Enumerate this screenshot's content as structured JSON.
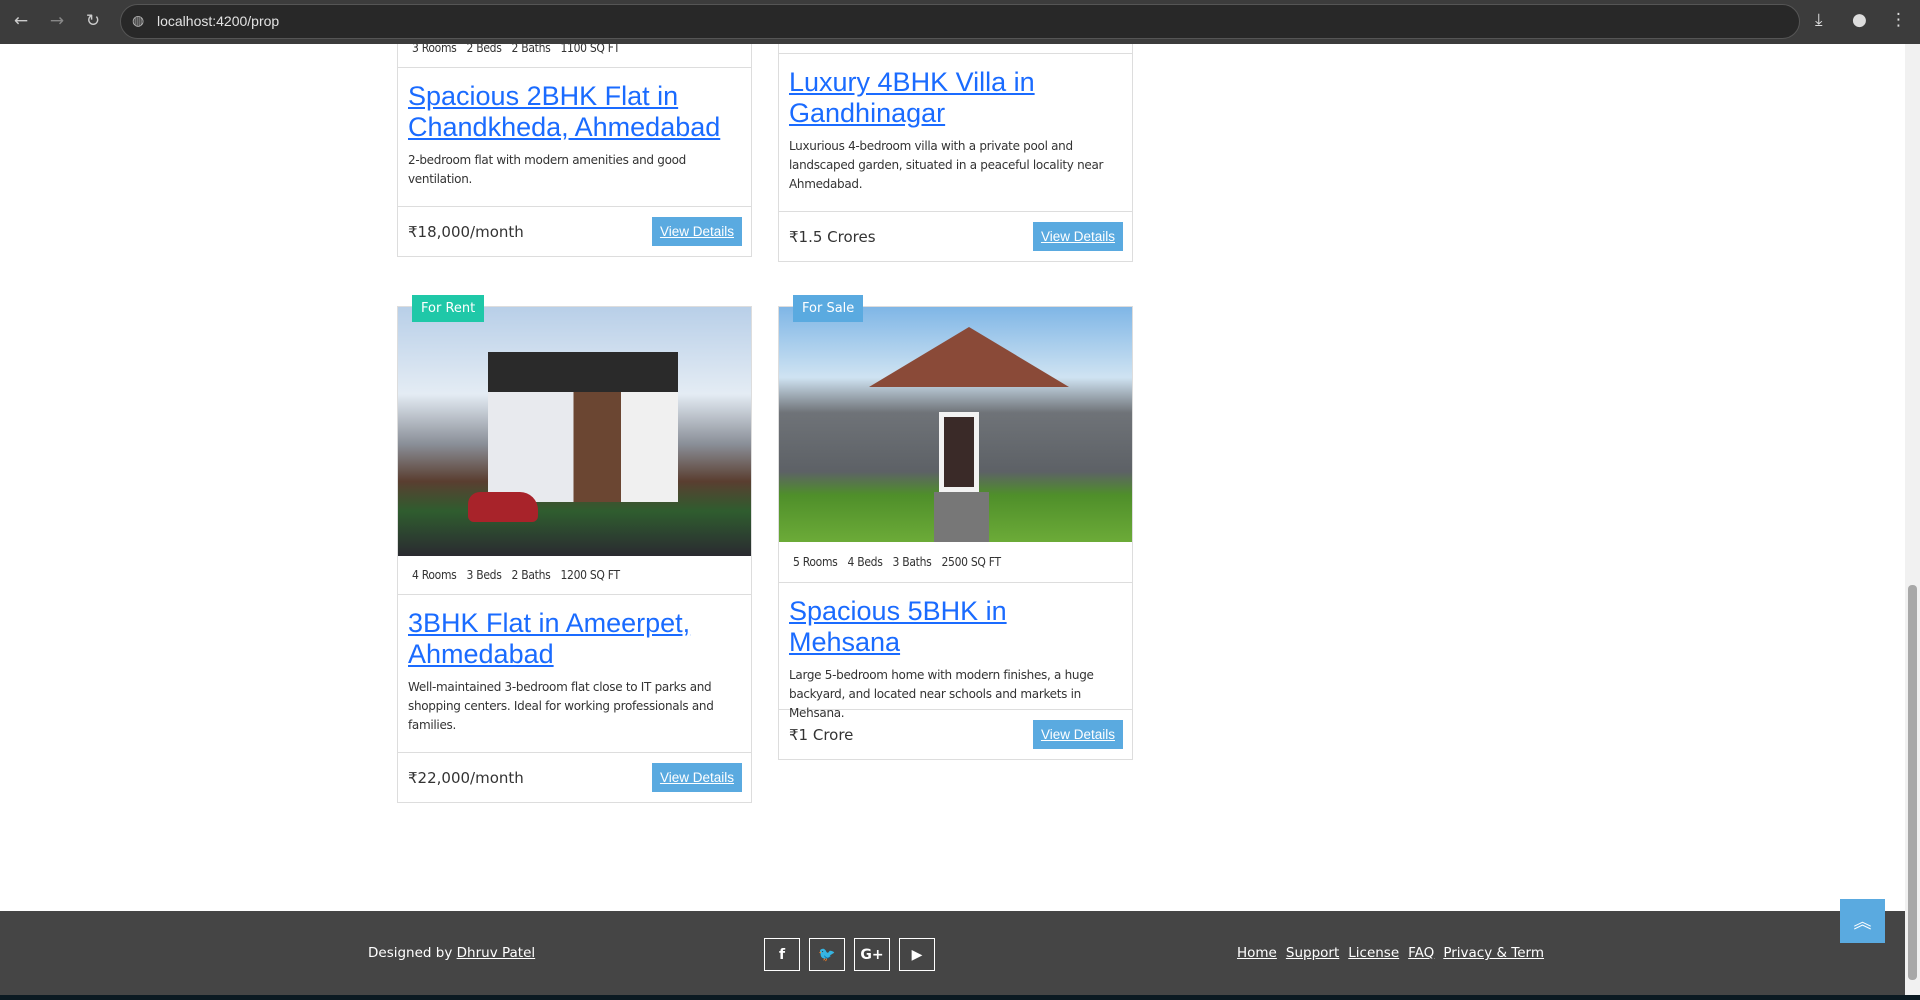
{
  "browser": {
    "url": "localhost:4200/prop"
  },
  "cards": [
    {
      "features": [
        "3 Rooms",
        "2 Beds",
        "2 Baths",
        "1100 SQ FT"
      ],
      "title": "Spacious 2BHK Flat in Chandkheda, Ahmedabad",
      "description": "2-bedroom flat with modern amenities and good ventilation.",
      "price": "₹18,000/month",
      "button": "View Details"
    },
    {
      "features": [],
      "title": "Luxury 4BHK Villa in Gandhinagar",
      "description": "Luxurious 4-bedroom villa with a private pool and landscaped garden, situated in a peaceful locality near Ahmedabad.",
      "price": "₹1.5 Crores",
      "button": "View Details"
    },
    {
      "badge": "For Rent",
      "badge_color": "#1fc8a8",
      "features": [
        "4 Rooms",
        "3 Beds",
        "2 Baths",
        "1200 SQ FT"
      ],
      "title": "3BHK Flat in Ameerpet, Ahmedabad",
      "description": "Well-maintained 3-bedroom flat close to IT parks and shopping centers. Ideal for working professionals and families.",
      "price": "₹22,000/month",
      "button": "View Details"
    },
    {
      "badge": "For Sale",
      "badge_color": "#5aaae0",
      "features": [
        "5 Rooms",
        "4 Beds",
        "3 Baths",
        "2500 SQ FT"
      ],
      "title": "Spacious 5BHK in Mehsana",
      "description": "Large 5-bedroom home with modern finishes, a huge backyard, and located near schools and markets in Mehsana.",
      "price": "₹1 Crore",
      "button": "View Details"
    }
  ],
  "footer": {
    "designed_by": "Designed by",
    "author": "Dhruv Patel",
    "social": [
      "facebook-icon",
      "twitter-icon",
      "google-plus-icon",
      "youtube-icon"
    ],
    "social_glyphs": [
      "f",
      "🐦",
      "G+",
      "▶"
    ],
    "links": [
      "Home",
      "Support",
      "License",
      "FAQ",
      "Privacy & Term"
    ]
  },
  "colors": {
    "link": "#1a6bff",
    "button": "#5aaae0",
    "footer": "#454545"
  }
}
